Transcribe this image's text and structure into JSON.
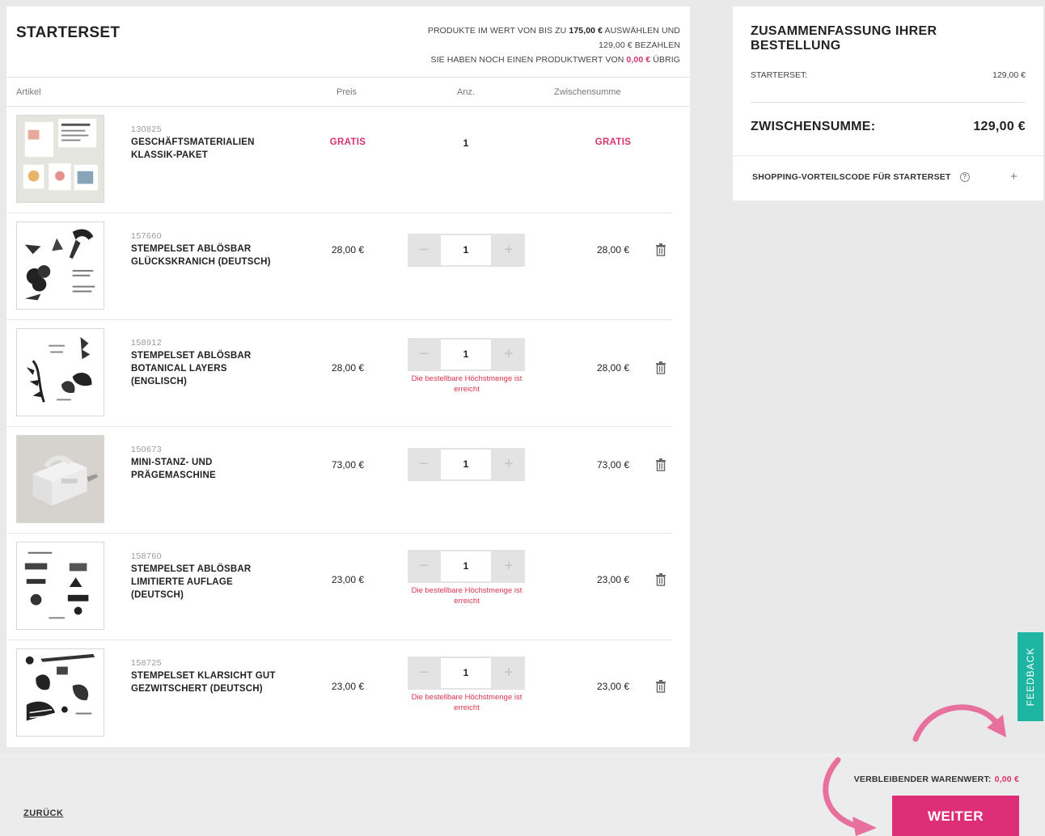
{
  "header": {
    "title": "STARTERSET",
    "note_line1_pre": "PRODUKTE IM WERT VON BIS ZU ",
    "note_line1_amount": "175,00 €",
    "note_line1_post": " AUSWÄHLEN UND",
    "note_line2": "129,00 € BEZAHLEN",
    "note_line3_pre": "SIE HABEN NOCH EINEN PRODUKTWERT VON ",
    "note_line3_amount": "0,00 €",
    "note_line3_post": " ÜBRIG"
  },
  "columns": {
    "article": "Artikel",
    "price": "Preis",
    "qty": "Anz.",
    "subtotal": "Zwischensumme"
  },
  "items": [
    {
      "sku": "130825",
      "name": "GESCHÄFTSMATERIALIEN KLASSIK-PAKET",
      "price": "GRATIS",
      "qty": "1",
      "subtotal": "GRATIS"
    },
    {
      "sku": "157660",
      "name": "STEMPELSET ABLÖSBAR GLÜCKSKRANICH (DEUTSCH)",
      "price": "28,00 €",
      "qty": "1",
      "subtotal": "28,00 €"
    },
    {
      "sku": "158912",
      "name": "STEMPELSET ABLÖSBAR BOTANICAL LAYERS (ENGLISCH)",
      "price": "28,00 €",
      "qty": "1",
      "subtotal": "28,00 €",
      "warning": "Die bestellbare Höchstmenge ist erreicht"
    },
    {
      "sku": "150673",
      "name": "MINI-STANZ- UND PRÄGEMASCHINE",
      "price": "73,00 €",
      "qty": "1",
      "subtotal": "73,00 €"
    },
    {
      "sku": "158760",
      "name": "STEMPELSET ABLÖSBAR LIMITIERTE AUFLAGE (DEUTSCH)",
      "price": "23,00 €",
      "qty": "1",
      "subtotal": "23,00 €",
      "warning": "Die bestellbare Höchstmenge ist erreicht"
    },
    {
      "sku": "158725",
      "name": "STEMPELSET KLARSICHT GUT GEZWITSCHERT (DEUTSCH)",
      "price": "23,00 €",
      "qty": "1",
      "subtotal": "23,00 €",
      "warning": "Die bestellbare Höchstmenge ist erreicht"
    }
  ],
  "stepper": {
    "minus": "−",
    "plus": "+"
  },
  "summary": {
    "title": "ZUSAMMENFASSUNG IHRER BESTELLUNG",
    "starterset_label": "STARTERSET:",
    "starterset_value": "129,00 €",
    "subtotal_label": "ZWISCHENSUMME:",
    "subtotal_value": "129,00 €",
    "promo_label": "SHOPPING-VORTEILSCODE FÜR STARTERSET",
    "promo_help": "?",
    "promo_plus": "+"
  },
  "feedback": "FEEDBACK",
  "footer": {
    "back": "ZURÜCK",
    "remaining_label": "VERBLEIBENDER WARENWERT:",
    "remaining_value": "0,00 €",
    "continue": "WEITER"
  },
  "colors": {
    "accent": "#de2e77",
    "pink_text": "#d6336c",
    "feedback": "#1eb6a2",
    "warning": "#d6334c"
  }
}
